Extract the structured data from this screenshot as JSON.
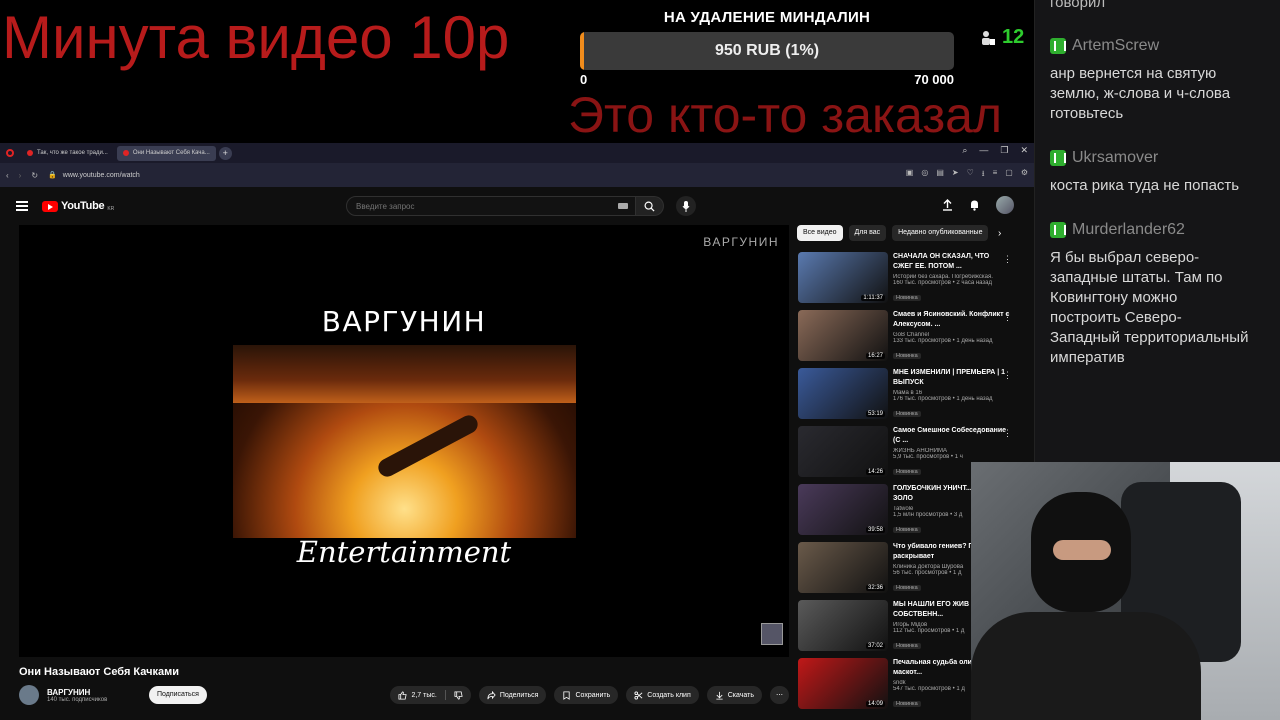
{
  "overlay": {
    "title": "Минута видео 10р",
    "ordered": "Это кто-то заказал",
    "goal_title": "НА УДАЛЕНИЕ МИНДАЛИН",
    "goal_value": "950 RUB (1%)",
    "goal_min": "0",
    "goal_max": "70 000",
    "goal_progress_percent": 1,
    "viewers": "12",
    "accent": "#f08c1c"
  },
  "chat": {
    "previous_tail": "говорил",
    "messages": [
      {
        "name": "ArtemScrew",
        "text": "анр вернется на святую землю, ж-слова и ч-слова готовьтесь"
      },
      {
        "name": "Ukrsamover",
        "text": "коста рика туда не попасть"
      },
      {
        "name": "Murderlander62",
        "text": "Я бы выбрал северо-западные штаты. Там по Ковингтону можно построить Северо-Западный территориальный императив"
      }
    ]
  },
  "browser": {
    "tabs": [
      {
        "label": "Так, что же такое тради..."
      },
      {
        "label": "Они Называют Себя Кача..."
      }
    ],
    "url": "www.youtube.com/watch"
  },
  "youtube": {
    "logo": "YouTube",
    "region": "KR",
    "search_placeholder": "Введите запрос",
    "watermark": "ВАРГУНИН",
    "video_overlay_title": "ВАРГУНИН",
    "video_overlay_subtitle": "Entertainment",
    "video_title": "Они Называют Себя Качками",
    "channel_name": "ВАРГУНИН",
    "channel_subs": "140 тыс. подписчиков",
    "subscribe": "Подписаться",
    "likes": "2,7 тыс.",
    "share": "Поделиться",
    "save": "Сохранить",
    "clip": "Создать клип",
    "download": "Скачать",
    "chips": [
      "Все видео",
      "Для вас",
      "Недавно опубликованные"
    ],
    "recommendations": [
      {
        "title": "СНАЧАЛА ОН СКАЗАЛ, ЧТО СЖЕГ ЕЕ. ПОТОМ ...",
        "channel": "Истории без сахара. Погребижская.",
        "meta": "160 тыс. просмотров • 2 часа назад",
        "badge": "Новинка",
        "duration": "1:11:37",
        "color": "#5a7ab0"
      },
      {
        "title": "Смаев и Ясиновский. Конфликт с Алексусом. ...",
        "channel": "GoB Channel",
        "meta": "133 тыс. просмотров • 1 день назад",
        "badge": "Новинка",
        "duration": "16:27",
        "color": "#8a6a58"
      },
      {
        "title": "МНЕ ИЗМЕНИЛИ | ПРЕМЬЕРА | 1 ВЫПУСК",
        "channel": "Мама в 16",
        "meta": "176 тыс. просмотров • 1 день назад",
        "badge": "Новинка",
        "duration": "53:19",
        "color": "#3a5a9a"
      },
      {
        "title": "Самое Смешное Собеседование (С ...",
        "channel": "ЖИЗНЬ АНОНИМА",
        "meta": "5,9 тыс. просмотров • 1 ч",
        "badge": "Новинка",
        "duration": "14:26",
        "color": "#2a2a30"
      },
      {
        "title": "ГОЛУБОЧКИН УНИЧТ... ИВАНА ЗОЛО",
        "channel": "Tatwole",
        "meta": "1,5 млн просмотров • 3 д",
        "badge": "Новинка",
        "duration": "39:58",
        "color": "#4a3a5a"
      },
      {
        "title": "Что убивало гениев? Психиатр раскрывает",
        "channel": "Клиника доктора Шурова",
        "meta": "56 тыс. просмотров • 1 д",
        "badge": "Новинка",
        "duration": "32:36",
        "color": "#6a5a4a"
      },
      {
        "title": "МЫ НАШЛИ ЕГО ЖИВ РУИНАХ СОБСТВЕНН...",
        "channel": "Игорь Мiдов",
        "meta": "112 тыс. просмотров • 1 д",
        "badge": "Новинка",
        "duration": "37:02",
        "color": "#5a5a5a"
      },
      {
        "title": "Печальная судьба олимпийских маскот...",
        "channel": "sndk",
        "meta": "547 тыс. просмотров • 1 д",
        "badge": "Новинка",
        "duration": "14:09",
        "color": "#c01818"
      }
    ]
  }
}
